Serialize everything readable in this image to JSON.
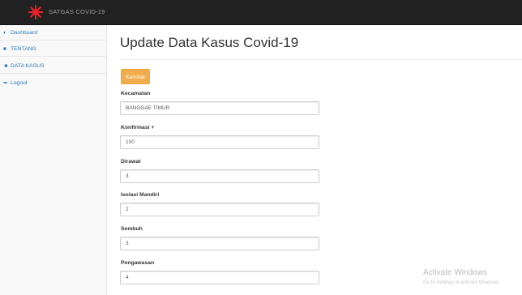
{
  "header": {
    "brand": "SATGAS COVID-19",
    "logo_icon": "red-virus-logo",
    "accent_color": "#e8202a"
  },
  "sidebar": {
    "items": [
      {
        "icon": "dashboard-icon",
        "glyph": "◐",
        "label": "Dashboard"
      },
      {
        "icon": "file-icon",
        "glyph": "■",
        "label": "TENTANG"
      },
      {
        "icon": "users-icon",
        "glyph": "☻",
        "label": "DATA KASUS"
      },
      {
        "icon": "sign-out-icon",
        "glyph": "➥",
        "label": "Logout"
      }
    ]
  },
  "main": {
    "title": "Update Data Kasus Covid-19",
    "back_button": "Kembali",
    "fields": [
      {
        "label": "Kecamatan",
        "value": "BANGGAE TIMUR"
      },
      {
        "label": "Konfirmasi +",
        "value": "100"
      },
      {
        "label": "Dirawat",
        "value": "3"
      },
      {
        "label": "Isolasi Mandiri",
        "value": "2"
      },
      {
        "label": "Sembuh",
        "value": "3"
      },
      {
        "label": "Pengawasan",
        "value": "4"
      }
    ]
  },
  "watermark": {
    "title": "Activate Windows",
    "subtitle": "Go to Settings to activate Windows."
  }
}
